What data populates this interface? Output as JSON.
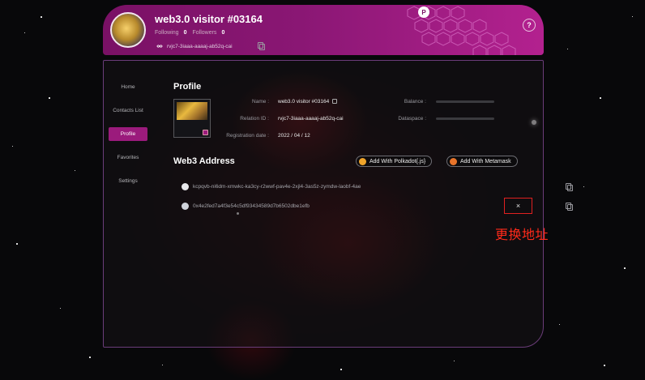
{
  "header": {
    "title": "web3.0 visitor #03164",
    "following_label": "Following",
    "following_count": "0",
    "followers_label": "Followers",
    "followers_count": "0",
    "principal_id": "rvjc7-3iaaa-aaaaj-ab52q-cai",
    "help_symbol": "?",
    "badge_symbol": "P"
  },
  "sidebar": {
    "items": [
      {
        "label": "Home"
      },
      {
        "label": "Contacts List"
      },
      {
        "label": "Profile"
      },
      {
        "label": "Favorites"
      },
      {
        "label": "Settings"
      }
    ],
    "active_index": 2
  },
  "profile": {
    "heading": "Profile",
    "name_label": "Name :",
    "name_value": "web3.0 visitor #03164",
    "relation_label": "Relation ID :",
    "relation_value": "rvjc7-3iaaa-aaaaj-ab52q-cai",
    "registration_label": "Registration date :",
    "registration_value": "2022 / 04 / 12",
    "balance_label": "Balance :",
    "dataspace_label": "Dataspace :"
  },
  "web3": {
    "heading": "Web3 Address",
    "add_polkadot_label": "Add With Polkadot{.js}",
    "add_metamask_label": "Add With Metamask",
    "addresses": [
      {
        "value": "kcpqvb-ni6dm-xmwkc-ka3cy-r2wwf-pav4e-2xjl4-3as5z-zymdw-laobf-4ae"
      },
      {
        "value": "0x4e2fed7a4f3e54c5df93434589d7b6502dbe1efb"
      }
    ],
    "close_symbol": "×"
  },
  "annotation": {
    "text": "更换地址",
    "color": "#ff2a1a"
  },
  "colors": {
    "brand": "#8a1774",
    "accent": "#9b1b7c",
    "annotation_border": "#e02020"
  }
}
